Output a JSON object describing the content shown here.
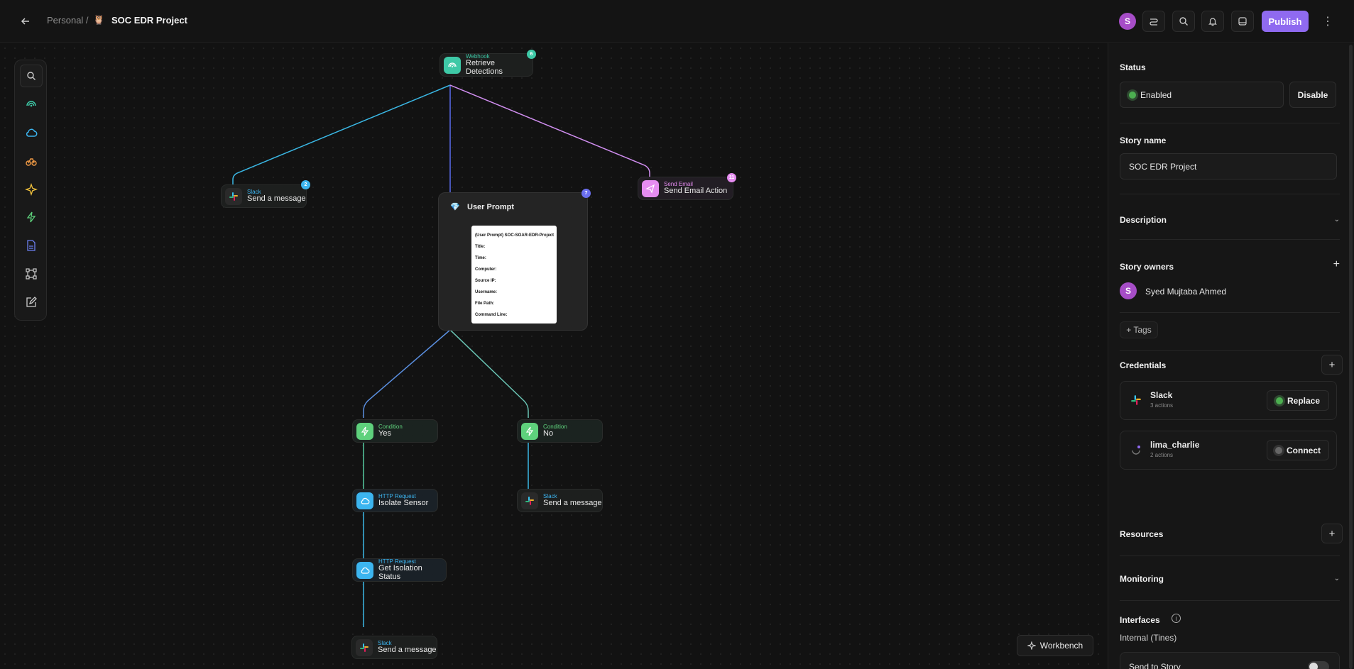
{
  "header": {
    "breadcrumb_parent": "Personal /",
    "project_emoji": "🦉",
    "project_title": "SOC EDR Project",
    "avatar_initial": "S",
    "publish_label": "Publish"
  },
  "canvas": {
    "nodes": {
      "webhook": {
        "type": "Webhook",
        "name": "Retrieve Detections",
        "badge": "6"
      },
      "slack_top": {
        "type": "Slack",
        "name": "Send a message",
        "badge": "2"
      },
      "email": {
        "type": "Send Email",
        "name": "Send Email Action",
        "badge": "11"
      },
      "prompt": {
        "title": "User Prompt",
        "badge": "7",
        "doc_lines": [
          "(User Prompt) SOC-SOAR-EDR-Project",
          "Title:",
          "Time:",
          "Computer:",
          "Source IP:",
          "Username:",
          "File Path:",
          "Command Line:"
        ]
      },
      "cond_yes": {
        "type": "Condition",
        "name": "Yes"
      },
      "cond_no": {
        "type": "Condition",
        "name": "No"
      },
      "isolate": {
        "type": "HTTP Request",
        "name": "Isolate Sensor"
      },
      "slack_no": {
        "type": "Slack",
        "name": "Send a message"
      },
      "get_status": {
        "type": "HTTP Request",
        "name": "Get Isolation Status"
      },
      "slack_bottom": {
        "type": "Slack",
        "name": "Send a message"
      }
    },
    "workbench_label": "Workbench",
    "colors": {
      "webhook": "#3ec9a7",
      "http": "#3cb5f0",
      "condition": "#5ed17c",
      "email": "#e58cf0",
      "prompt": "#6b6ff0"
    }
  },
  "panel": {
    "status_label": "Status",
    "status_value": "Enabled",
    "disable_label": "Disable",
    "story_name_label": "Story name",
    "story_name_value": "SOC EDR Project",
    "description_label": "Description",
    "owners_label": "Story owners",
    "owner_initial": "S",
    "owner_name": "Syed Mujtaba Ahmed",
    "tags_label": "+ Tags",
    "credentials_label": "Credentials",
    "credentials": [
      {
        "name": "Slack",
        "sub": "3 actions",
        "action": "Replace"
      },
      {
        "name": "lima_charlie",
        "sub": "2 actions",
        "action": "Connect"
      }
    ],
    "resources_label": "Resources",
    "monitoring_label": "Monitoring",
    "interfaces_label": "Interfaces",
    "interfaces_sub": "Internal (Tines)",
    "send_to_story_label": "Send to Story"
  }
}
